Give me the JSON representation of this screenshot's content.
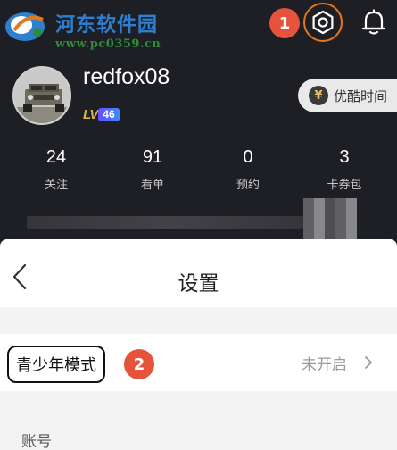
{
  "watermark": {
    "title": "河东软件园",
    "url": "www.pc0359.cn"
  },
  "annotations": {
    "step1": "1",
    "step2": "2"
  },
  "profile": {
    "username": "redfox08",
    "level_prefix": "LV",
    "level": "46",
    "promo": {
      "coin_symbol": "¥",
      "label": "优酷时间"
    },
    "stats": [
      {
        "value": "24",
        "label": "关注"
      },
      {
        "value": "91",
        "label": "看单"
      },
      {
        "value": "0",
        "label": "预约"
      },
      {
        "value": "3",
        "label": "卡券包"
      }
    ]
  },
  "settings": {
    "title": "设置",
    "youth_mode": {
      "label": "青少年模式",
      "status": "未开启"
    },
    "account_section": "账号"
  },
  "colors": {
    "header_bg": "#1e1f24",
    "accent_orange": "#e8751a",
    "badge_red": "#e5533c",
    "panel_bg": "#f3f3f3"
  },
  "icons": {
    "settings": "gear-icon",
    "notifications": "bell-icon",
    "back": "chevron-left-icon",
    "row_arrow": "chevron-right-icon"
  }
}
